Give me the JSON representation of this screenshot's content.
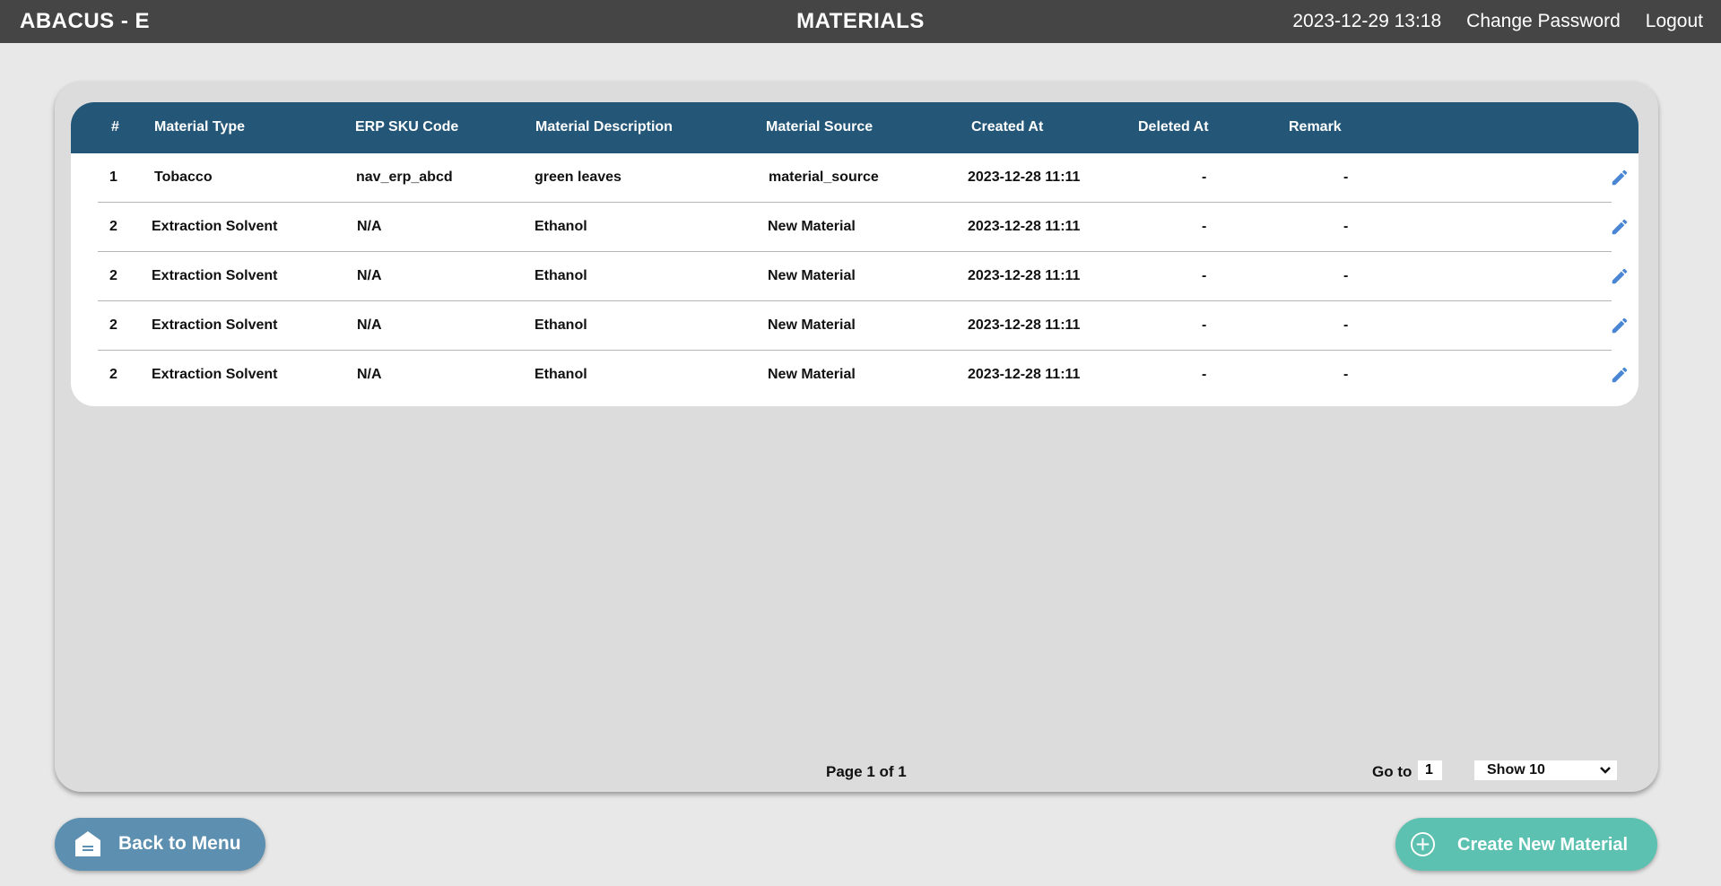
{
  "header": {
    "brand": "ABACUS - E",
    "title": "MATERIALS",
    "datetime": "2023-12-29 13:18",
    "change_password": "Change Password",
    "logout": "Logout"
  },
  "table": {
    "columns": [
      "#",
      "Material Type",
      "ERP SKU Code",
      "Material Description",
      "Material Source",
      "Created At",
      "Deleted At",
      "Remark"
    ],
    "rows": [
      [
        "1",
        "Tobacco",
        "nav_erp_abcd",
        "green leaves",
        "material_source",
        "2023-12-28 11:11",
        "-",
        "-"
      ],
      [
        "2",
        "Extraction Solvent",
        "N/A",
        "Ethanol",
        "New Material",
        "2023-12-28 11:11",
        "-",
        "-"
      ],
      [
        "2",
        "Extraction Solvent",
        "N/A",
        "Ethanol",
        "New Material",
        "2023-12-28 11:11",
        "-",
        "-"
      ],
      [
        "2",
        "Extraction Solvent",
        "N/A",
        "Ethanol",
        "New Material",
        "2023-12-28 11:11",
        "-",
        "-"
      ],
      [
        "2",
        "Extraction Solvent",
        "N/A",
        "Ethanol",
        "New Material",
        "2023-12-28 11:11",
        "-",
        "-"
      ]
    ],
    "edit_icon": "pencil-icon"
  },
  "pagination": {
    "page_info": "Page 1 of 1",
    "goto_label": "Go to",
    "goto_value": "1",
    "show_label": "Show 10"
  },
  "footer": {
    "back_label": "Back to Menu",
    "back_icon": "home-icon",
    "create_label": "Create New Material",
    "create_icon": "plus-circle-icon"
  },
  "colors": {
    "topbar": "#454545",
    "table_header": "#245677",
    "edit_icon": "#4a86d4",
    "back_button": "#5c8fb0",
    "create_button": "#5cc1b0"
  }
}
